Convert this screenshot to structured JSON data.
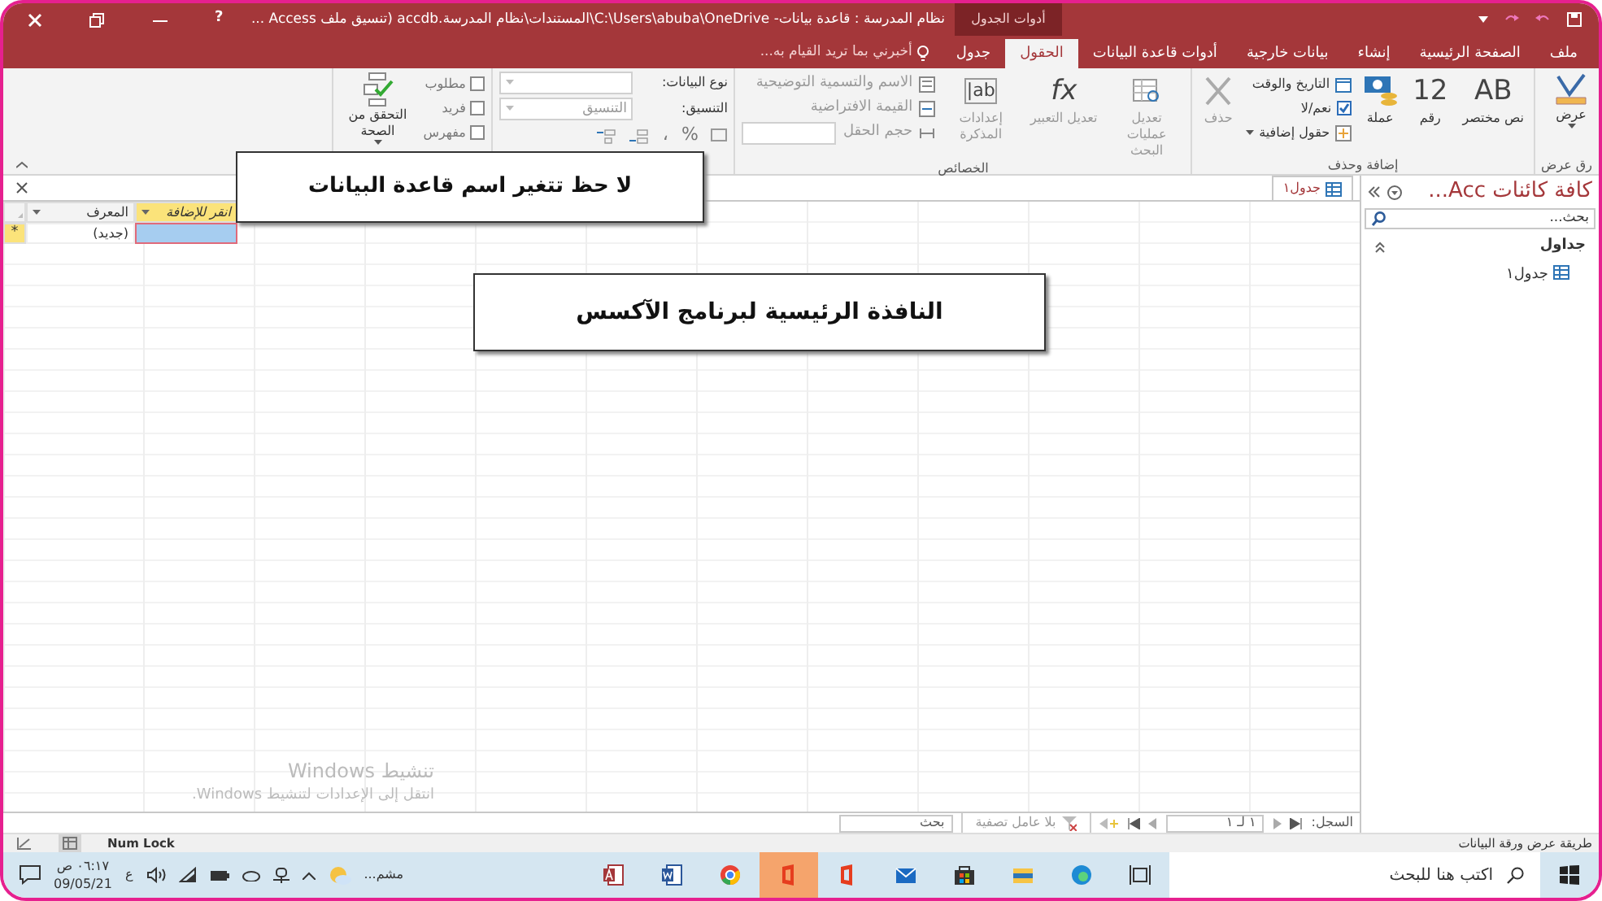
{
  "title_bar": {
    "title": "نظام المدرسة : قاعدة بيانات- C:\\Users\\abuba\\OneDrive\\المستندات\\نظام المدرسة.accdb (تنسيق ملف Access ...",
    "context_label": "أدوات الجدول",
    "help": "?"
  },
  "tabs": [
    {
      "label": "ملف",
      "selected": false
    },
    {
      "label": "الصفحة الرئيسية",
      "selected": false
    },
    {
      "label": "إنشاء",
      "selected": false
    },
    {
      "label": "بيانات خارجية",
      "selected": false
    },
    {
      "label": "أدوات قاعدة البيانات",
      "selected": false
    },
    {
      "label": "الحقول",
      "selected": true
    },
    {
      "label": "جدول",
      "selected": false
    }
  ],
  "tell_me": "أخبرني بما تريد القيام به...",
  "ribbon": {
    "views": {
      "label": "رق عرض",
      "button": "عرض"
    },
    "add_delete": {
      "label": "إضافة وحذف",
      "big": [
        {
          "glyph": "AB",
          "label": "نص مختصر"
        },
        {
          "glyph": "12",
          "label": "رقم"
        },
        {
          "label": "عملة"
        }
      ],
      "small": [
        {
          "kind": "icon",
          "label": "التاريخ والوقت"
        },
        {
          "kind": "check",
          "label": "نعم/لا",
          "checked": true
        },
        {
          "kind": "dropdown",
          "label": "حقول إضافية"
        }
      ],
      "delete": {
        "label": "حذف",
        "disabled": true
      }
    },
    "properties": {
      "label": "الخصائص",
      "rows": [
        {
          "label": "الاسم والتسمية التوضيحية",
          "disabled": true
        },
        {
          "label": "القيمة الافتراضية",
          "disabled": true
        },
        {
          "label": "حجم الحقل",
          "disabled": true
        }
      ],
      "buttons": [
        {
          "label": "تعديل عمليات البحث",
          "disabled": true
        },
        {
          "glyph": "fx",
          "label": "تعديل التعبير",
          "disabled": true
        },
        {
          "glyph": "ab|",
          "label": "إعدادات المذكرة",
          "disabled": true
        }
      ]
    },
    "formatting": {
      "data_type_label": "نوع البيانات:",
      "format_label": "التنسيق:",
      "format_placeholder": "التنسيق",
      "symbols": [
        "%",
        "،"
      ]
    },
    "validation": {
      "checks": [
        {
          "label": "مطلوب",
          "checked": false
        },
        {
          "label": "فريد",
          "checked": false
        },
        {
          "label": "مفهرس",
          "checked": false
        }
      ],
      "button": "التحقق من الصحة"
    }
  },
  "nav_pane": {
    "title": "كافة كائنات Acc...",
    "search_placeholder": "بحث...",
    "groups": [
      {
        "label": "جداول",
        "expanded": true,
        "items": [
          {
            "label": "جدول١",
            "selected": false
          }
        ]
      }
    ]
  },
  "document": {
    "tab": "جدول١",
    "columns": [
      {
        "label": "انقر للإضافة",
        "selected": true
      },
      {
        "label": "المعرف",
        "selected": false,
        "new_value": "(جديد)"
      }
    ],
    "new_row": {
      "marker": "*"
    }
  },
  "record_nav": {
    "label": "السجل:",
    "position": "١ لـ ١",
    "filter": "بلا عامل تصفية",
    "search_placeholder": "بحث"
  },
  "activation": {
    "title": "تنشيط Windows",
    "subtitle": "انتقل إلى الإعدادات لتنشيط Windows."
  },
  "status_bar": {
    "left": "Num Lock",
    "right": "طريقة عرض ورقة البيانات"
  },
  "taskbar": {
    "search_placeholder": "اكتب هنا للبحث",
    "apps": [
      {
        "kind": "taskview",
        "selected": false
      },
      {
        "kind": "edge",
        "selected": false
      },
      {
        "kind": "explorer",
        "selected": false
      },
      {
        "kind": "store",
        "selected": false
      },
      {
        "kind": "mail",
        "selected": false
      },
      {
        "kind": "office",
        "selected": false
      },
      {
        "kind": "office",
        "selected": true
      },
      {
        "kind": "chrome",
        "selected": false
      },
      {
        "kind": "word",
        "selected": false
      },
      {
        "kind": "access",
        "selected": false
      }
    ],
    "weather": "مشم...",
    "language": "ع",
    "time": "٠٦:١٧ ص",
    "date": "09/05/21"
  },
  "callouts": [
    {
      "text": "لا حظ تتغير اسم قاعدة البيانات"
    },
    {
      "text": "النافذة الرئيسية لبرنامج الآكسس"
    }
  ]
}
